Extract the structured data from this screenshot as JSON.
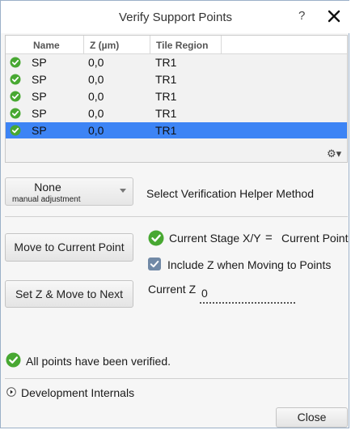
{
  "window": {
    "title": "Verify Support Points",
    "help_label": "?"
  },
  "table": {
    "columns": [
      "Name",
      "Z (µm)",
      "Tile Region"
    ],
    "rows": [
      {
        "name": "SP",
        "z": "0,0",
        "region": "TR1",
        "status": "verified"
      },
      {
        "name": "SP",
        "z": "0,0",
        "region": "TR1",
        "status": "verified"
      },
      {
        "name": "SP",
        "z": "0,0",
        "region": "TR1",
        "status": "verified"
      },
      {
        "name": "SP",
        "z": "0,0",
        "region": "TR1",
        "status": "verified"
      },
      {
        "name": "SP",
        "z": "0,0",
        "region": "TR1",
        "status": "verified",
        "selected": true
      }
    ],
    "settings_icon": "gear-icon"
  },
  "helper": {
    "selected_value": "None",
    "selected_sub": "manual adjustment",
    "label": "Select Verification Helper Method"
  },
  "controls": {
    "move_button": "Move to Current Point",
    "setz_button": "Set Z & Move to Next",
    "stage_label": "Current Stage X/Y",
    "equals": "=",
    "current_point": "Current Point",
    "include_z_label": "Include Z when Moving to Points",
    "include_z_checked": true,
    "current_z_label": "Current Z",
    "current_z_value": "0"
  },
  "status": {
    "message": "All points have been verified."
  },
  "dev": {
    "label": "Development Internals"
  },
  "footer": {
    "close_button": "Close"
  },
  "colors": {
    "selection": "#3d84f5",
    "ok_green": "#48a832",
    "checkbox": "#7189a6"
  }
}
